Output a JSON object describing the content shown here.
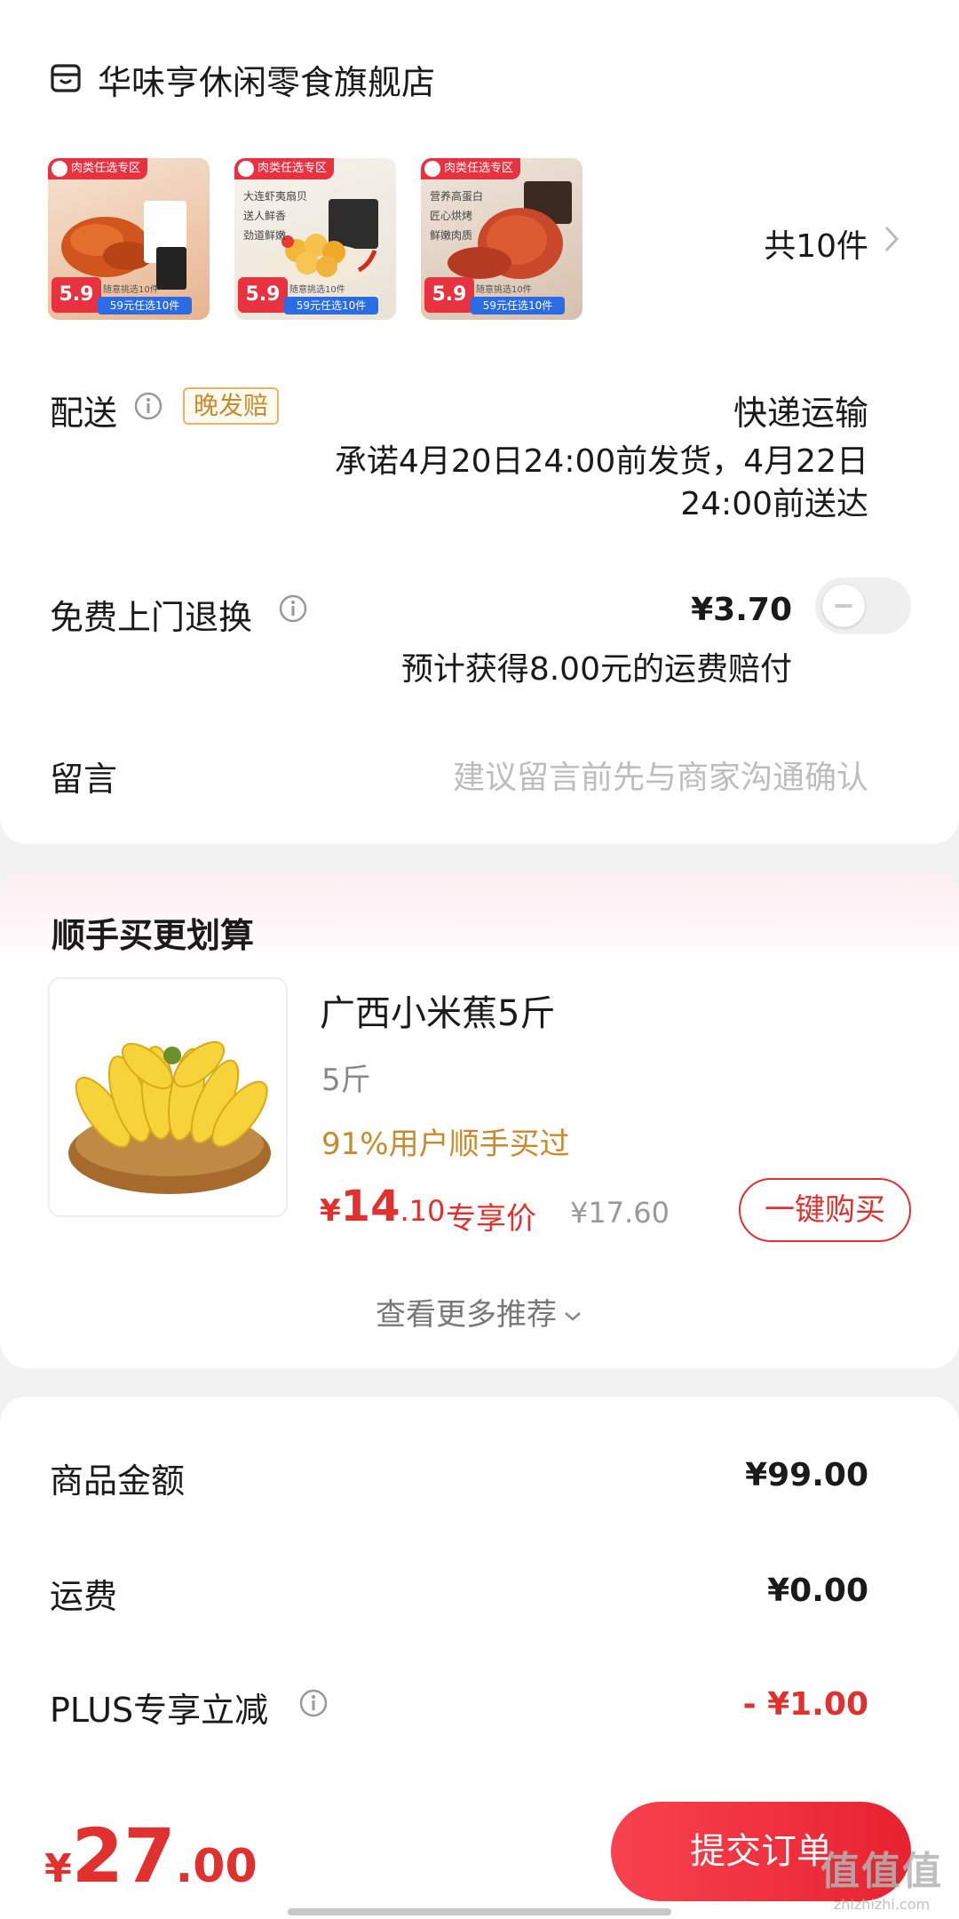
{
  "store": {
    "name": "华味亨休闲零食旗舰店",
    "icon": "store-icon"
  },
  "items": {
    "thumbnails": [
      {
        "tag": "肉类任选专区",
        "price": "5.9",
        "promo": "59元任选10件",
        "sub": "随意挑选10件",
        "lines": [
          "",
          "",
          ""
        ],
        "bg": "#f3d9c8"
      },
      {
        "tag": "肉类任选专区",
        "price": "5.9",
        "promo": "59元任选10件",
        "sub": "随意挑选10件",
        "lines": [
          "大连虾夷扇贝",
          "送人鲜香",
          "劲道鲜嫩"
        ],
        "bg": "#f3efe6"
      },
      {
        "tag": "肉类任选专区",
        "price": "5.9",
        "promo": "59元任选10件",
        "sub": "随意挑选10件",
        "lines": [
          "营养高蛋白",
          "匠心烘烤",
          "鲜嫩肉质"
        ],
        "bg": "#e8dcd2"
      }
    ],
    "count_label": "共10件"
  },
  "delivery": {
    "label": "配送",
    "badge": "晚发赔",
    "method": "快递运输",
    "promise_line1": "承诺4月20日24:00前发货，4月22日",
    "promise_line2": "24:00前送达"
  },
  "return_service": {
    "label": "免费上门退换",
    "price": "¥3.70",
    "note": "预计获得8.00元的运费赔付",
    "enabled": false
  },
  "message": {
    "label": "留言",
    "placeholder": "建议留言前先与商家沟通确认"
  },
  "recommend": {
    "title": "顺手买更划算",
    "product": {
      "name": "广西小米蕉5斤",
      "spec": "5斤",
      "hint": "91%用户顺手买过",
      "price_yen": "¥",
      "price_int": "14",
      "price_dec": ".10",
      "vip_label": "专享价",
      "orig_price": "¥17.60",
      "buy_label": "一键购买"
    },
    "more_label": "查看更多推荐"
  },
  "summary": {
    "goods_label": "商品金额",
    "goods_value": "¥99.00",
    "shipping_label": "运费",
    "shipping_value": "¥0.00",
    "plus_label": "PLUS专享立减",
    "plus_value": "- ¥1.00"
  },
  "footer": {
    "total_yen": "¥",
    "total_int": "27",
    "total_dec": ".00",
    "submit_label": "提交订单",
    "watermark_big": "值值值",
    "watermark_small": "zhizhizhi.com"
  },
  "colors": {
    "accent_red": "#e0312f",
    "badge_gold": "#c98a2c",
    "promo_blue": "#2b6be3"
  }
}
